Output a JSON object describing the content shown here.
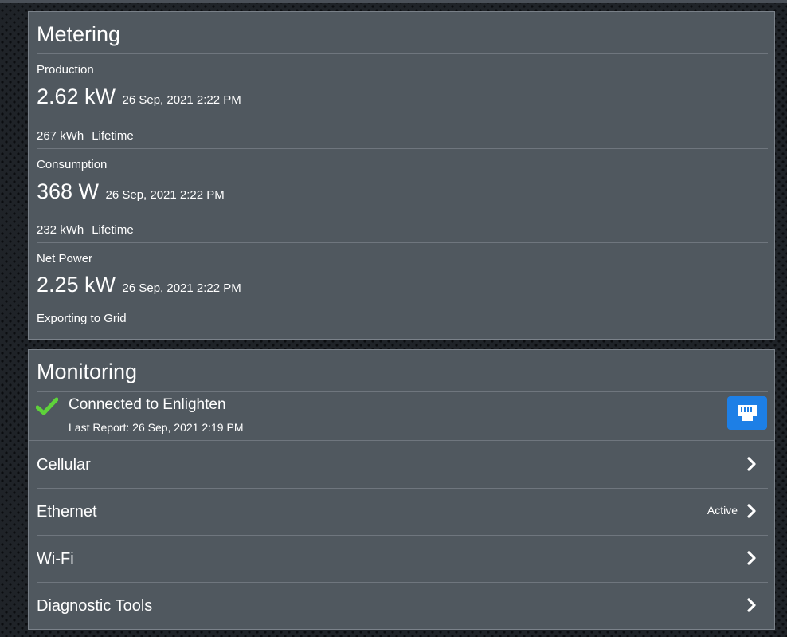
{
  "metering": {
    "title": "Metering",
    "production": {
      "label": "Production",
      "value": "2.62 kW",
      "timestamp": "26 Sep, 2021 2:22 PM",
      "lifetime_value": "267 kWh",
      "lifetime_label": "Lifetime"
    },
    "consumption": {
      "label": "Consumption",
      "value": "368 W",
      "timestamp": "26 Sep, 2021 2:22 PM",
      "lifetime_value": "232 kWh",
      "lifetime_label": "Lifetime"
    },
    "net_power": {
      "label": "Net Power",
      "value": "2.25 kW",
      "timestamp": "26 Sep, 2021 2:22 PM",
      "status": "Exporting to Grid"
    }
  },
  "monitoring": {
    "title": "Monitoring",
    "connection": {
      "title": "Connected to Enlighten",
      "last_report": "Last Report: 26 Sep, 2021 2:19 PM",
      "status_icon": "check-icon",
      "type_icon": "ethernet-port-icon"
    },
    "items": [
      {
        "label": "Cellular",
        "status": ""
      },
      {
        "label": "Ethernet",
        "status": "Active"
      },
      {
        "label": "Wi-Fi",
        "status": ""
      },
      {
        "label": "Diagnostic Tools",
        "status": ""
      }
    ]
  },
  "colors": {
    "panel_bg": "#50585f",
    "accent_blue": "#1d7fe6",
    "check_green": "#5ed23a"
  }
}
